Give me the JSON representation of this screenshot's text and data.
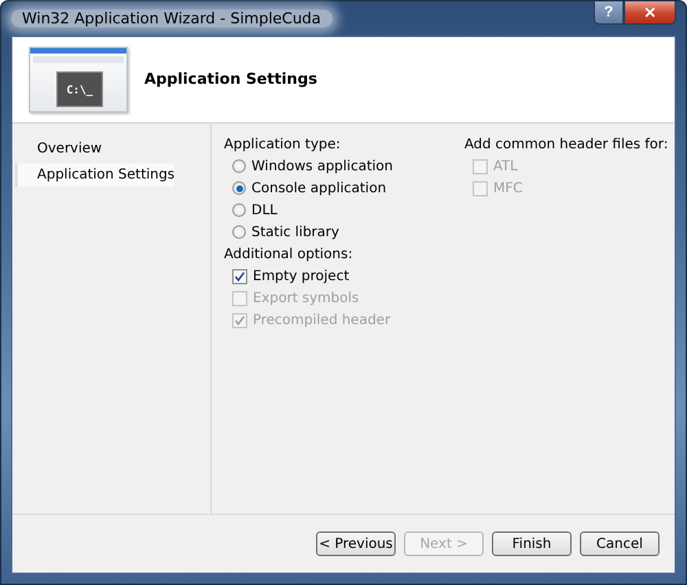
{
  "window": {
    "title": "Win32 Application Wizard - SimpleCuda",
    "controls": [
      "?",
      "✕"
    ]
  },
  "header": {
    "title": "Application Settings",
    "prompt": "C:\\_"
  },
  "sidebar": {
    "items": [
      {
        "label": "Overview",
        "selected": false
      },
      {
        "label": "Application Settings",
        "selected": true
      }
    ]
  },
  "application_type": {
    "label": "Application type:",
    "options": [
      {
        "label": "Windows application",
        "selected": false
      },
      {
        "label": "Console application",
        "selected": true
      },
      {
        "label": "DLL",
        "selected": false
      },
      {
        "label": "Static library",
        "selected": false
      }
    ]
  },
  "additional_options": {
    "label": "Additional options:",
    "options": [
      {
        "label": "Empty project",
        "checked": true,
        "disabled": false
      },
      {
        "label": "Export symbols",
        "checked": false,
        "disabled": true
      },
      {
        "label": "Precompiled header",
        "checked": true,
        "disabled": true
      }
    ]
  },
  "header_files": {
    "label": "Add common header files for:",
    "options": [
      {
        "label": "ATL",
        "checked": false,
        "disabled": true
      },
      {
        "label": "MFC",
        "checked": false,
        "disabled": true
      }
    ]
  },
  "buttons": [
    {
      "label": "< Previous",
      "disabled": false
    },
    {
      "label": "Next >",
      "disabled": true
    },
    {
      "label": "Finish",
      "disabled": false
    },
    {
      "label": "Cancel",
      "disabled": false
    }
  ]
}
